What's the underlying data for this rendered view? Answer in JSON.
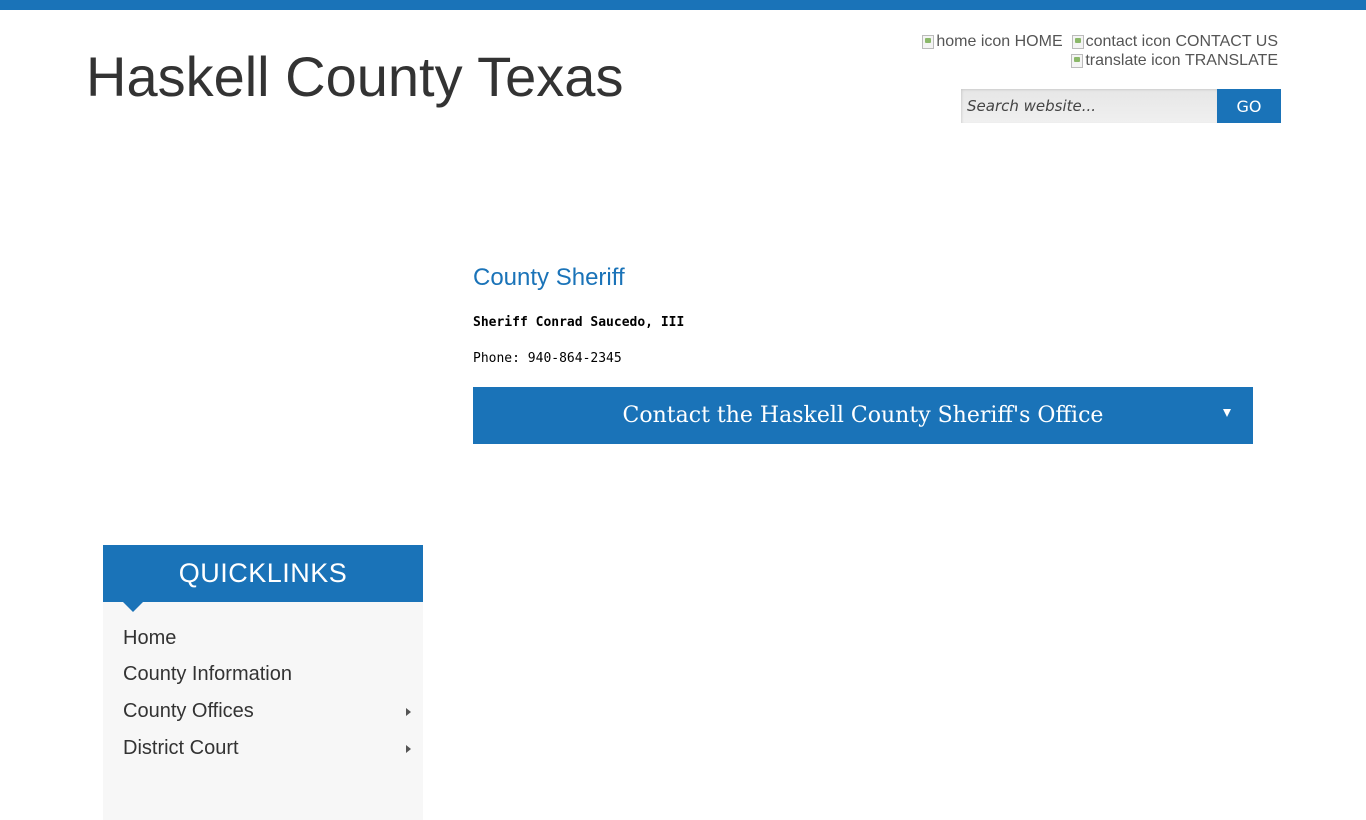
{
  "site": {
    "title": "Haskell County Texas"
  },
  "utility_links": [
    {
      "icon": "home-icon",
      "alt": "home icon",
      "label": "HOME"
    },
    {
      "icon": "contact-icon",
      "alt": "contact icon",
      "label": "CONTACT US"
    },
    {
      "icon": "translate-icon",
      "alt": "translate icon",
      "label": "TRANSLATE"
    }
  ],
  "search": {
    "placeholder": "Search website...",
    "button_label": "GO"
  },
  "main": {
    "heading": "County Sheriff",
    "officer": "Sheriff Conrad Saucedo, III",
    "phone": "Phone: 940-864-2345",
    "accordion_title": "Contact the Haskell County Sheriff's Office"
  },
  "quicklinks": {
    "title": "QUICKLINKS",
    "items": [
      {
        "label": "Home",
        "has_submenu": false
      },
      {
        "label": "County Information",
        "has_submenu": false
      },
      {
        "label": "County Offices",
        "has_submenu": true
      },
      {
        "label": "District Court",
        "has_submenu": true
      }
    ]
  },
  "colors": {
    "brand_blue": "#1a73b8",
    "text": "#333333"
  }
}
